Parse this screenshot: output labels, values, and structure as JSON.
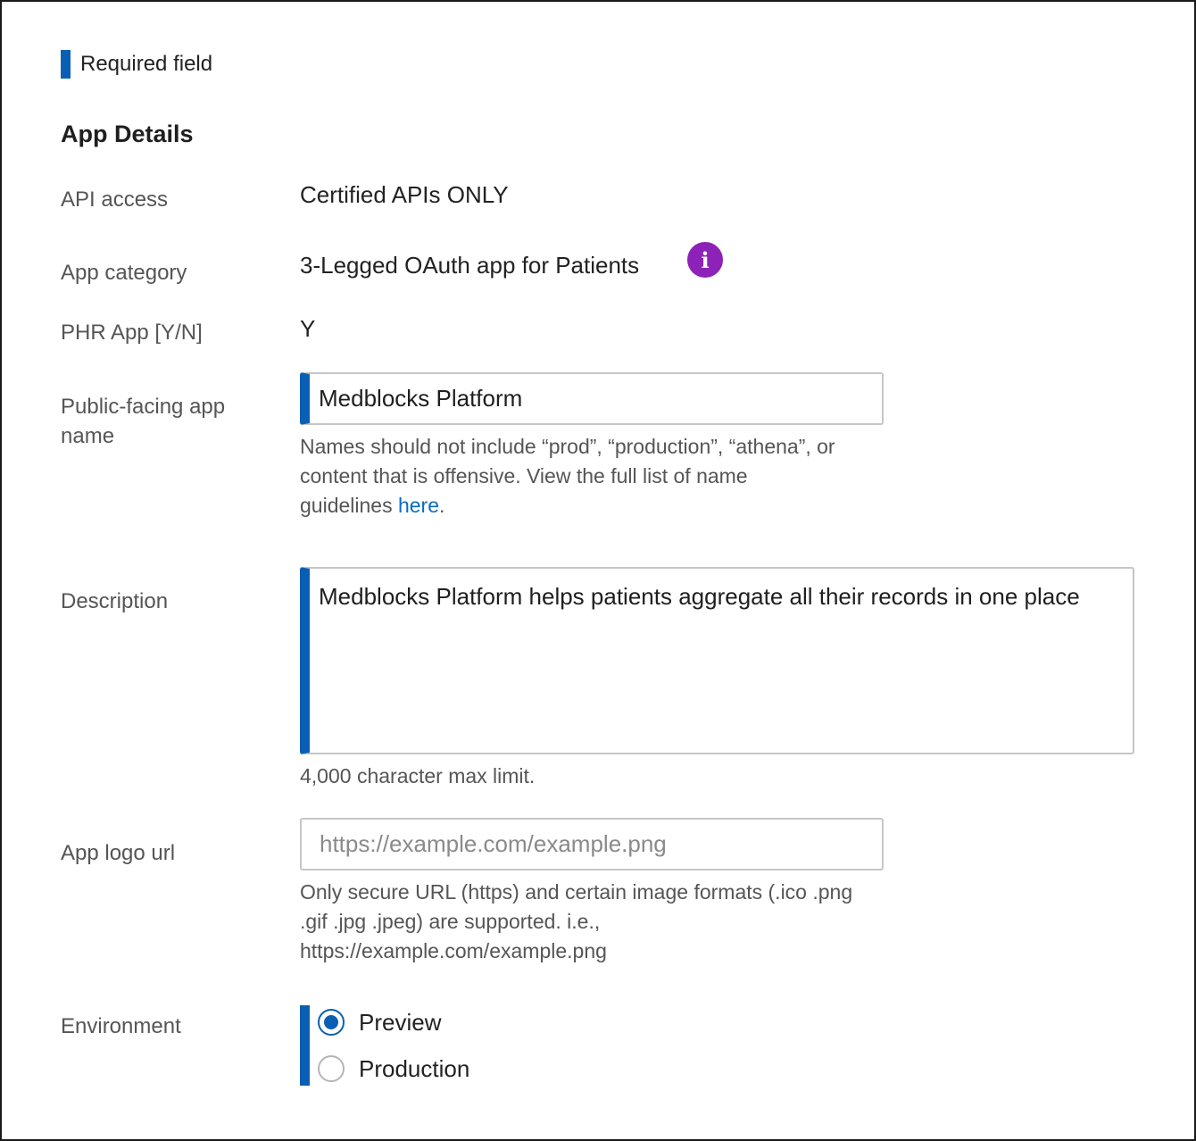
{
  "legend": {
    "required_label": "Required field"
  },
  "section": {
    "title": "App Details"
  },
  "fields": {
    "api_access": {
      "label": "API access",
      "value": "Certified APIs ONLY"
    },
    "app_category": {
      "label": "App category",
      "value": "3-Legged OAuth app for Patients",
      "info_icon": "info-icon",
      "info_glyph": "i"
    },
    "phr_app": {
      "label": "PHR App [Y/N]",
      "value": "Y"
    },
    "public_name": {
      "label": "Public-facing app name",
      "value": "Medblocks Platform",
      "help_line1": "Names should not include “prod”, “production”, “athena”, or",
      "help_line2": "content that is offensive. View the full list of name",
      "help_line3_prefix": "guidelines ",
      "help_link": "here",
      "help_line3_suffix": "."
    },
    "description": {
      "label": "Description",
      "value": "Medblocks Platform helps patients aggregate all their records in one place",
      "help": "4,000 character max limit."
    },
    "logo_url": {
      "label": "App logo url",
      "value": "",
      "placeholder": "https://example.com/example.png",
      "help_line1": "Only secure URL (https) and certain image formats (.ico .png",
      "help_line2": ".gif .jpg .jpeg) are supported. i.e.,",
      "help_line3": "https://example.com/example.png"
    },
    "environment": {
      "label": "Environment",
      "options": [
        {
          "label": "Preview",
          "selected": true
        },
        {
          "label": "Production",
          "selected": false
        }
      ]
    }
  },
  "colors": {
    "required_accent": "#0a5fb4",
    "info_icon": "#8c22b8",
    "link": "#0a6bc4"
  }
}
